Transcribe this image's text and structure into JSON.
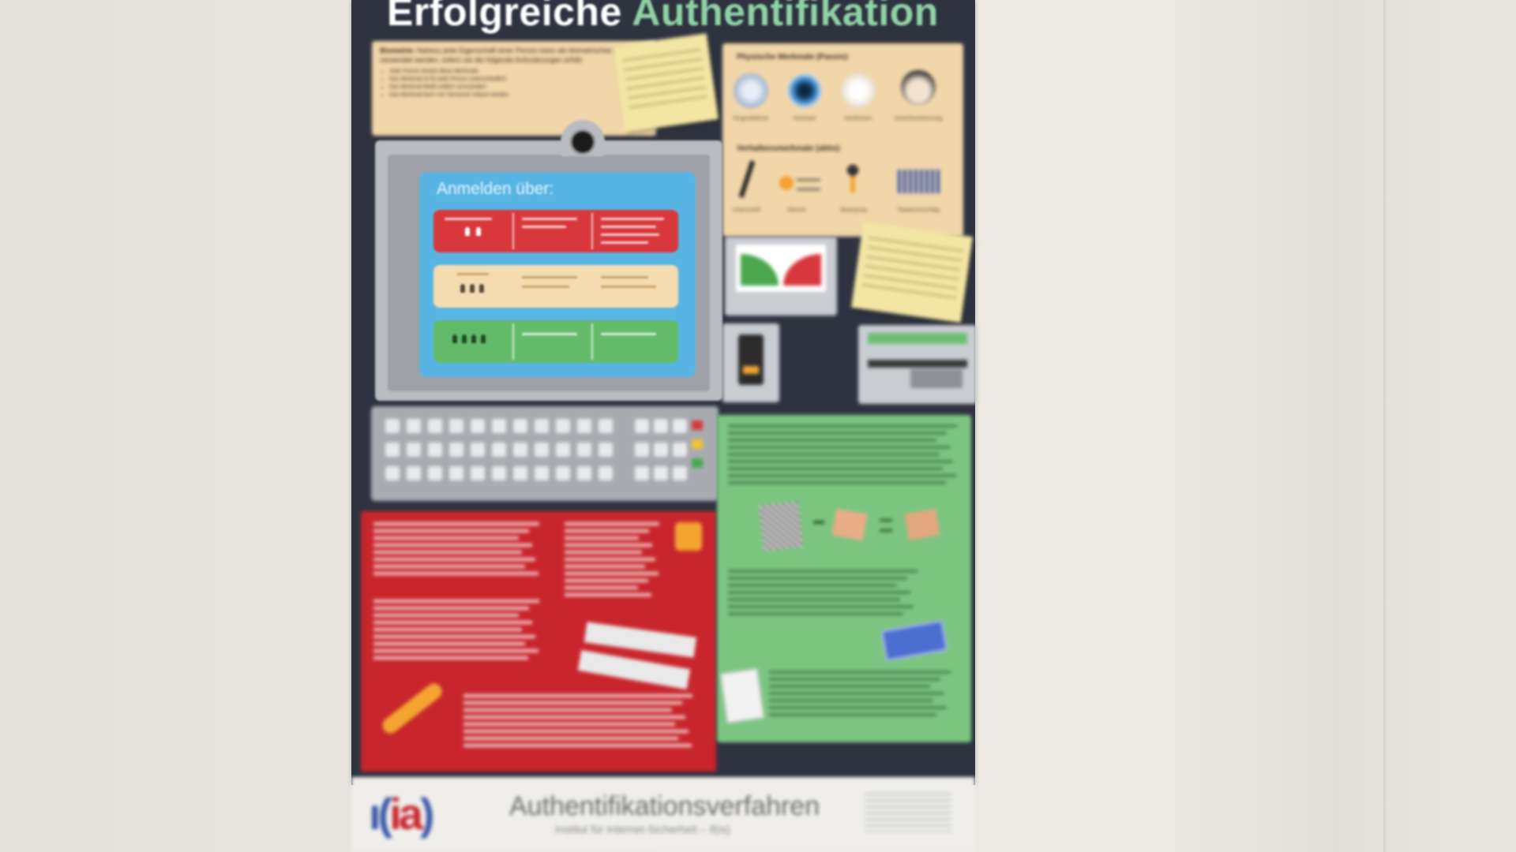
{
  "poster": {
    "title_word1": "Erfolgreiche",
    "title_word2": "Authentifikation",
    "bio_term": "Biometrie:",
    "bio_text": "Nahezu jede Eigenschaft einer Person kann als biometrisches Merkmal verwendet werden, sofern sie die folgende Anforderungen erfüllt:",
    "bio_bullets": [
      "Jede Person besitzt diese Merkmale",
      "Das Merkmal ist für jede Person unterschiedlich",
      "Das Merkmal bleibt zeitlich unverändert",
      "Das Merkmal kann von Sensoren erfasst werden"
    ],
    "physical_heading": "Physische Merkmale (Passiv):",
    "physical_items": [
      "Fingerabdruck",
      "Netzhaut",
      "Handvenen",
      "Gesichtserkennung"
    ],
    "behavior_heading": "Verhaltensmerkmale (aktiv):",
    "behavior_items": [
      "Unterschrift",
      "Stimme",
      "Bewegung",
      "Tastaturanschlag"
    ],
    "screen_title": "Anmelden über:"
  },
  "footer": {
    "logo_left": "ı(",
    "logo_mid": "ia",
    "logo_right": ")",
    "title": "Authentifikationsverfahren",
    "subtitle": "Institut für Internet-Sicherheit – if(is)"
  },
  "colors": {
    "poster_bg": "#2f3340",
    "title_accent": "#8fd2a6",
    "panel_beige": "#f1d6a9",
    "screen_blue": "#58b5e3",
    "option_red": "#d8383c",
    "option_beige": "#f4dcb0",
    "option_green": "#63bb6a",
    "red_panel": "#c8262c",
    "green_panel": "#7cc581"
  }
}
